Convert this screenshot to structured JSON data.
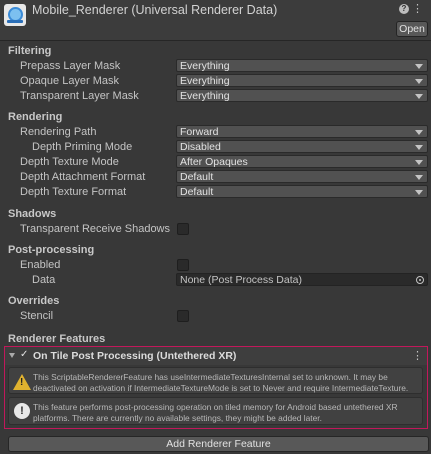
{
  "header": {
    "title": "Mobile_Renderer (Universal Renderer Data)",
    "open_label": "Open",
    "help_glyph": "?",
    "menu_glyph": "⋮",
    "icon": "renderer-asset-icon"
  },
  "filtering": {
    "title": "Filtering",
    "rows": [
      {
        "label": "Prepass Layer Mask",
        "value": "Everything"
      },
      {
        "label": "Opaque Layer Mask",
        "value": "Everything"
      },
      {
        "label": "Transparent Layer Mask",
        "value": "Everything"
      }
    ]
  },
  "rendering": {
    "title": "Rendering",
    "rows": [
      {
        "label": "Rendering Path",
        "value": "Forward"
      },
      {
        "label": "Depth Priming Mode",
        "value": "Disabled"
      },
      {
        "label": "Depth Texture Mode",
        "value": "After Opaques"
      },
      {
        "label": "Depth Attachment Format",
        "value": "Default"
      },
      {
        "label": "Depth Texture Format",
        "value": "Default"
      }
    ]
  },
  "shadows": {
    "title": "Shadows",
    "transparent_receive_label": "Transparent Receive Shadows",
    "transparent_receive_checked": false
  },
  "post_processing": {
    "title": "Post-processing",
    "enabled_label": "Enabled",
    "enabled_checked": false,
    "data_label": "Data",
    "data_value": "None (Post Process Data)"
  },
  "overrides": {
    "title": "Overrides",
    "stencil_label": "Stencil",
    "stencil_checked": false
  },
  "renderer_features": {
    "title": "Renderer Features",
    "feature": {
      "checkmark": "✓",
      "name": "On Tile Post Processing (Untethered XR)",
      "menu_glyph": "⋮",
      "warning": "This ScriptableRendererFeature has useIntermediateTexturesInternal set to unknown. It may be deactivated on activation if IntermediateTextureMode is set to Never and require IntermediateTexture.",
      "info": "This feature performs post-processing operation on tiled memory for Android based untethered XR platforms. There are currently no available settings, they might be added later."
    },
    "add_label": "Add Renderer Feature"
  },
  "colors": {
    "highlight_border": "#c2185b",
    "warning_icon": "#e0b22f"
  }
}
